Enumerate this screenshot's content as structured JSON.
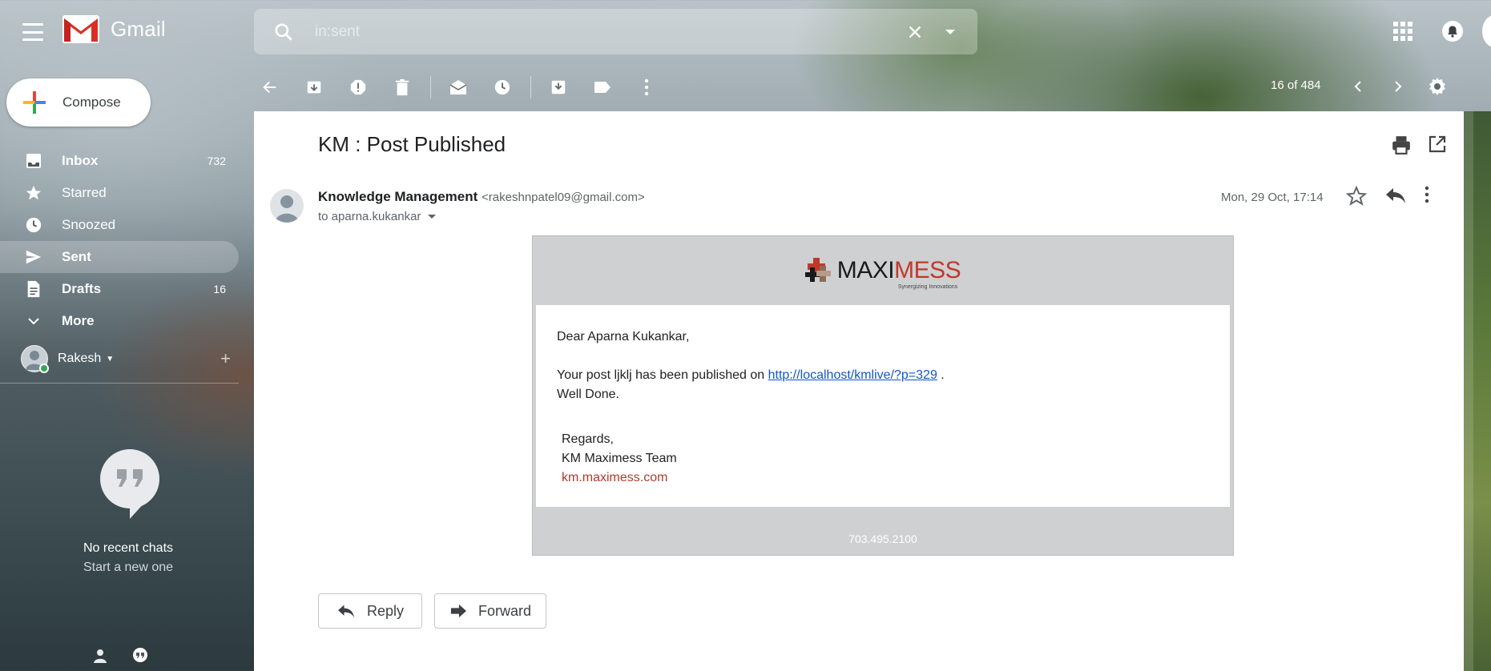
{
  "app": {
    "name": "Gmail"
  },
  "search": {
    "value": "in:sent"
  },
  "compose": {
    "label": "Compose"
  },
  "nav": [
    {
      "label": "Inbox",
      "count": "732",
      "icon": "inbox-icon"
    },
    {
      "label": "Starred",
      "count": "",
      "icon": "star-icon"
    },
    {
      "label": "Snoozed",
      "count": "",
      "icon": "clock-icon"
    },
    {
      "label": "Sent",
      "count": "",
      "icon": "send-icon"
    },
    {
      "label": "Drafts",
      "count": "16",
      "icon": "draft-icon"
    },
    {
      "label": "More",
      "count": "",
      "icon": "chevron-down-icon"
    }
  ],
  "user": {
    "name": "Rakesh"
  },
  "chat": {
    "empty": "No recent chats",
    "start": "Start a new one"
  },
  "pager": {
    "text": "16 of 484"
  },
  "message": {
    "subject": "KM : Post Published",
    "sender_name": "Knowledge Management",
    "sender_email": "<rakeshnpatel09@gmail.com>",
    "to": "to aparna.kukankar",
    "date": "Mon, 29 Oct, 17:14"
  },
  "mail": {
    "brand_a": "MAXI",
    "brand_b": "MESS",
    "tagline": "Synergizing Innovations",
    "greeting": "Dear Aparna Kukankar,",
    "line1_prefix": "Your post ljklj has been published on",
    "link": "http://localhost/kmlive/?p=329",
    "line1_suffix": ".",
    "line2": "Well Done.",
    "regards": "Regards,",
    "team": "KM Maximess Team",
    "site": "km.maximess.com",
    "phone": "703.495.2100"
  },
  "actions": {
    "reply": "Reply",
    "forward": "Forward"
  },
  "colors": {
    "accent_red": "#c0392b",
    "link": "#1155cc",
    "compose_bg": "#ffffff"
  }
}
